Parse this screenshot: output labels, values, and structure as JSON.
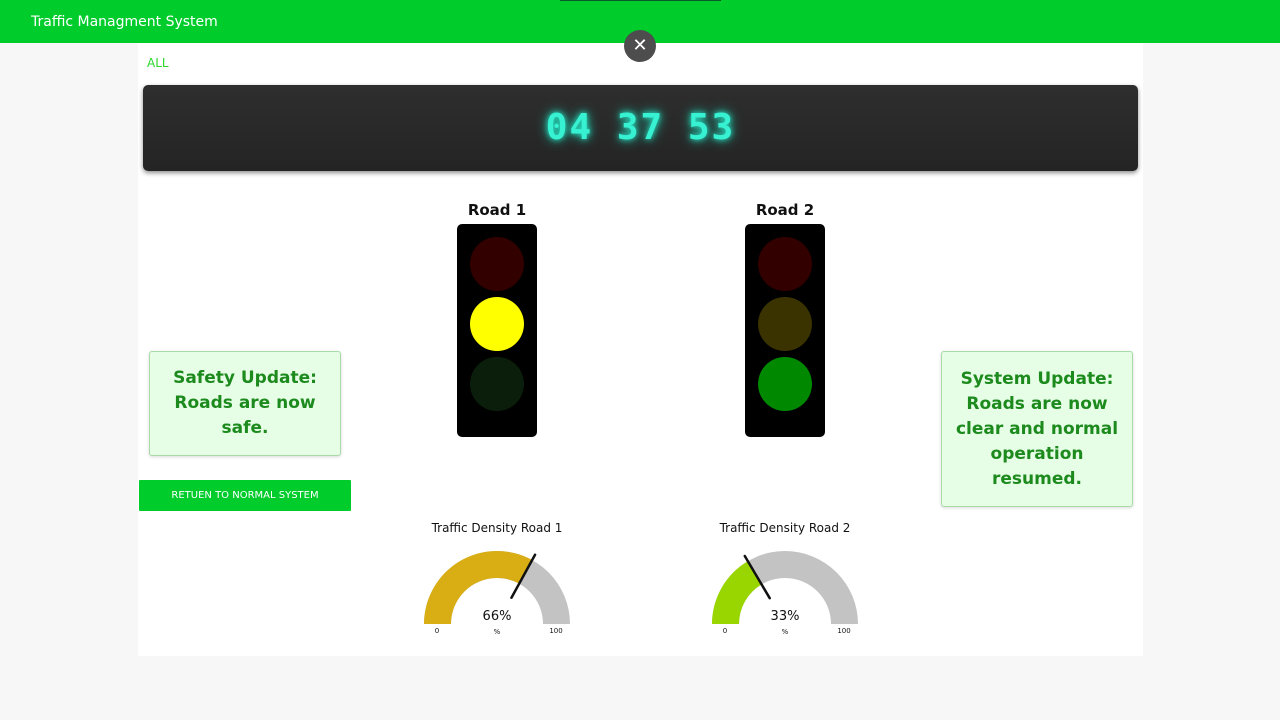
{
  "app": {
    "title": "Traffic Managment System",
    "close_symbol": "✕"
  },
  "filters": {
    "all_label": "ALL"
  },
  "clock": {
    "time": "04 37 53"
  },
  "roads": [
    {
      "label": "Road 1",
      "active_light": "yellow"
    },
    {
      "label": "Road 2",
      "active_light": "green"
    }
  ],
  "notices": {
    "left": [
      "Safety Update:",
      "Roads are now",
      "safe."
    ],
    "right": [
      "System Update:",
      "Roads are now",
      "clear and normal",
      "operation",
      "resumed."
    ]
  },
  "actions": {
    "return_label": "RETUEN TO NORMAL SYSTEM"
  },
  "gauges": [
    {
      "title": "Traffic Density Road 1",
      "value": 66,
      "value_text": "66%",
      "min": "0",
      "max": "100",
      "unit": "%",
      "color": "#d9ad14"
    },
    {
      "title": "Traffic Density Road 2",
      "value": 33,
      "value_text": "33%",
      "min": "0",
      "max": "100",
      "unit": "%",
      "color": "#99d600"
    }
  ],
  "colors": {
    "brand": "#00cc2c",
    "lamp_on": {
      "red": "#ff0000",
      "yellow": "#ffff00",
      "green": "#008800"
    },
    "lamp_off": {
      "red": "#330000",
      "yellow": "#3a3300",
      "green": "#0b1e0b"
    }
  }
}
